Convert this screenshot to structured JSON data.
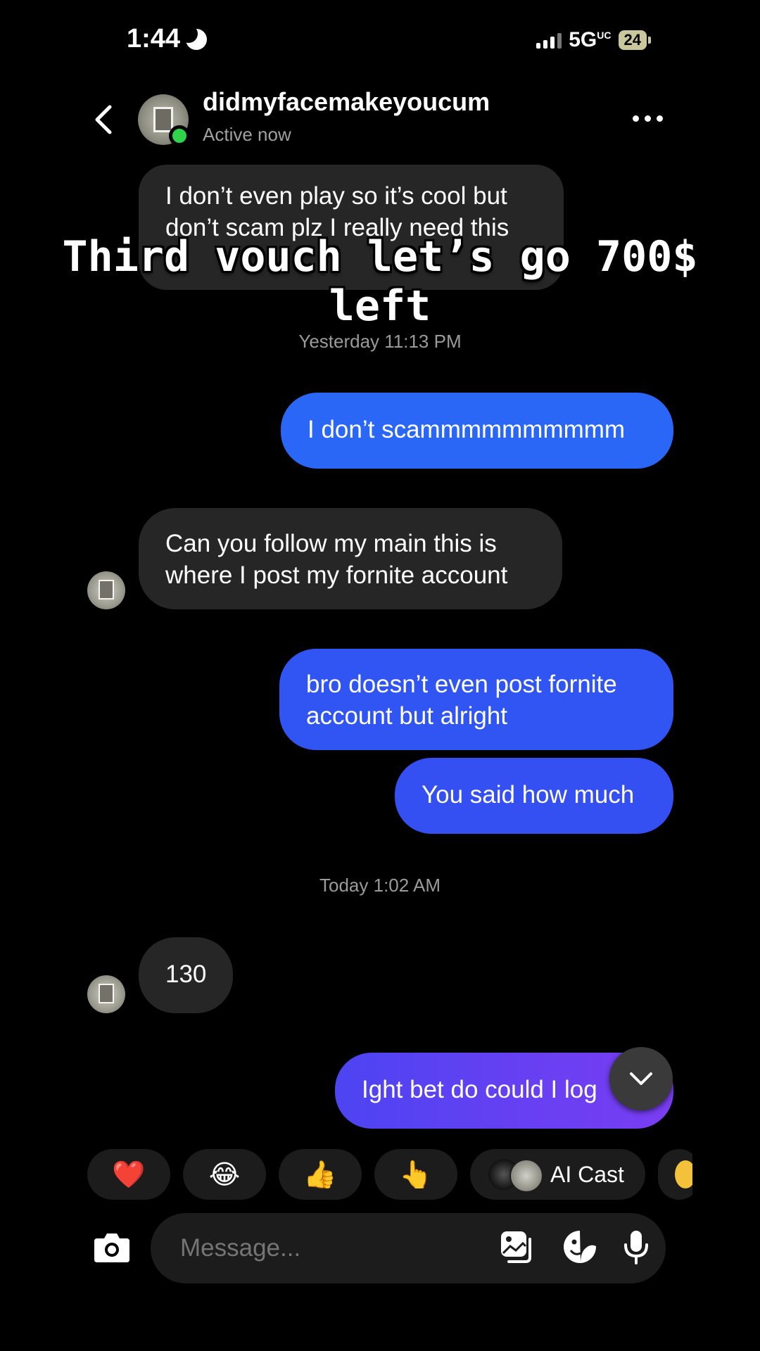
{
  "status_bar": {
    "time": "1:44",
    "network": "5G",
    "network_suffix": "UC",
    "battery": "24"
  },
  "header": {
    "username": "didmyfacemakeyoucum",
    "status": "Active now"
  },
  "overlay_caption": "Third vouch let’s go 700$ left",
  "messages": [
    {
      "side": "incoming",
      "lines": [
        "I don’t even play so it’s cool but",
        "don’t scam plz I really need this"
      ]
    },
    {
      "type": "timestamp",
      "text": "Yesterday 11:13 PM"
    },
    {
      "side": "outgoing",
      "lines": [
        "I don’t scammmmmmmmmm"
      ]
    },
    {
      "side": "incoming",
      "lines": [
        "Can you follow my main this is",
        "where I post my fornite account"
      ]
    },
    {
      "side": "outgoing",
      "lines": [
        "bro doesn’t even post fornite",
        "account but alright"
      ]
    },
    {
      "side": "outgoing",
      "lines": [
        "You said how much"
      ]
    },
    {
      "type": "timestamp",
      "text": "Today 1:02 AM"
    },
    {
      "side": "incoming",
      "lines": [
        "130"
      ]
    },
    {
      "side": "outgoing",
      "lines": [
        "Ight bet do could I log"
      ]
    }
  ],
  "quick_reactions": [
    {
      "icon": "heart-emoji",
      "glyph": "❤️"
    },
    {
      "icon": "laughing-emoji",
      "glyph": "😂"
    },
    {
      "icon": "thumbs-up-emoji",
      "glyph": "👍"
    },
    {
      "icon": "pointing-emoji",
      "glyph": "👆"
    },
    {
      "icon": "ai-cast-avatars",
      "label": "AI Cast"
    }
  ],
  "composer": {
    "placeholder": "Message..."
  },
  "colors": {
    "background": "#000000",
    "incoming_bubble": "#262626",
    "outgoing_blue": "#2f63f5",
    "outgoing_purple": "#7a3df2",
    "online": "#2fd44b"
  }
}
